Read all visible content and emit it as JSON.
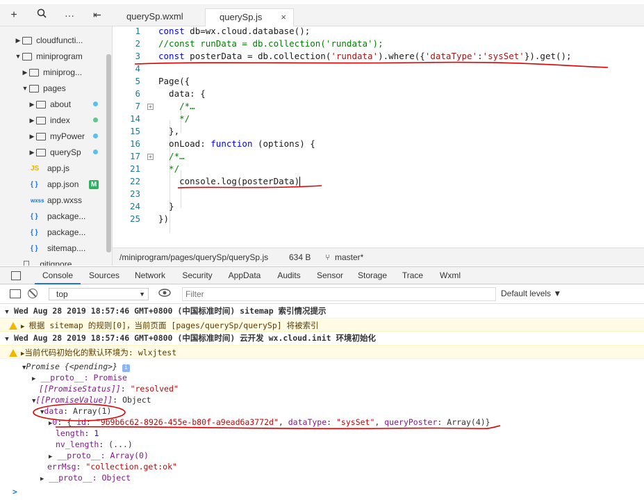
{
  "file_toolbar": {
    "add_icon": "plus-icon",
    "search_icon": "search-icon",
    "more_icon": "more-icon",
    "collapse_icon": "collapse-icon"
  },
  "sidebar": {
    "items": [
      {
        "label": "cloudfuncti...",
        "kind": "folder",
        "expanded": false
      },
      {
        "label": "miniprogram",
        "kind": "folder",
        "expanded": true
      },
      {
        "label": "miniprog...",
        "kind": "folder",
        "expanded": false
      },
      {
        "label": "pages",
        "kind": "folder",
        "expanded": true
      },
      {
        "label": "about",
        "kind": "folder",
        "expanded": false
      },
      {
        "label": "index",
        "kind": "folder",
        "expanded": false
      },
      {
        "label": "myPower",
        "kind": "folder",
        "expanded": false
      },
      {
        "label": "querySp",
        "kind": "folder",
        "expanded": false
      },
      {
        "label": "app.js",
        "kind": "file",
        "icon": "JS"
      },
      {
        "label": "app.json",
        "kind": "file",
        "icon": "{ }",
        "badge": "M"
      },
      {
        "label": "app.wxss",
        "kind": "file",
        "icon": "wxss"
      },
      {
        "label": "package...",
        "kind": "file",
        "icon": "{ }"
      },
      {
        "label": "package...",
        "kind": "file",
        "icon": "{ }"
      },
      {
        "label": "sitemap....",
        "kind": "file",
        "icon": "{ }"
      },
      {
        "label": ".gitignore",
        "kind": "file",
        "icon": ""
      }
    ]
  },
  "tabs": [
    {
      "label": "querySp.wxml",
      "active": false
    },
    {
      "label": "querySp.js",
      "active": true,
      "close": "×"
    }
  ],
  "editor": {
    "lines": [
      {
        "n": "1",
        "text": "const db=wx.cloud.database();"
      },
      {
        "n": "2",
        "text": "//const runData = db.collection('rundata');"
      },
      {
        "n": "3",
        "text": "const posterData = db.collection('rundata').where({'dataType':'sysSet'}).get();"
      },
      {
        "n": "4",
        "text": ""
      },
      {
        "n": "5",
        "text": "Page({"
      },
      {
        "n": "6",
        "text": "  data: {"
      },
      {
        "n": "7",
        "text": "    /*…"
      },
      {
        "n": "14",
        "text": "    */"
      },
      {
        "n": "15",
        "text": "  },"
      },
      {
        "n": "16",
        "text": "  onLoad: function (options) {"
      },
      {
        "n": "17",
        "text": "  /*…"
      },
      {
        "n": "21",
        "text": "  */"
      },
      {
        "n": "22",
        "text": "    console.log(posterData)"
      },
      {
        "n": "23",
        "text": ""
      },
      {
        "n": "24",
        "text": "  }"
      },
      {
        "n": "25",
        "text": "})"
      }
    ]
  },
  "statusbar": {
    "path": "/miniprogram/pages/querySp/querySp.js",
    "size": "634 B",
    "branch": "master*"
  },
  "devtools": {
    "tabs": [
      "Console",
      "Sources",
      "Network",
      "Security",
      "AppData",
      "Audits",
      "Sensor",
      "Storage",
      "Trace",
      "Wxml"
    ],
    "active_tab": "Console",
    "context": "top",
    "filter_placeholder": "Filter",
    "levels": "Default levels ▼"
  },
  "console": {
    "log1_time": "Wed Aug 28 2019 18:57:46 GMT+0800 (中国标准时间) sitemap 索引情况提示",
    "warn1": "根据 sitemap 的规则[0]，当前页面 [pages/querySp/querySp] 将被索引",
    "log2_time": "Wed Aug 28 2019 18:57:46 GMT+0800 (中国标准时间) 云开发 wx.cloud.init 环境初始化",
    "warn2": "当前代码初始化的默认环境为: wlxjtest",
    "promise": "Promise {<pending>}",
    "proto1": "__proto__: Promise",
    "status_key": "[[PromiseStatus]]",
    "status_val": "\"resolved\"",
    "value_key": "[[PromiseValue]]",
    "value_val": "Object",
    "data_key": "data",
    "data_val": "Array(1)",
    "item0_key": "0",
    "item0_id_key": "_id",
    "item0_id_val": "\"9b9b6c62-8926-455e-b80f-a9ead6a3772d\"",
    "item0_type_key": "dataType",
    "item0_type_val": "\"sysSet\"",
    "item0_qp_key": "queryPoster",
    "item0_qp_val": "Array(4)",
    "length_key": "length",
    "length_val": "1",
    "nvlength_key": "nv_length",
    "nvlength_val": "(...)",
    "proto2": "__proto__: Array(0)",
    "errmsg_key": "errMsg",
    "errmsg_val": "\"collection.get:ok\"",
    "proto3": "__proto__: Object",
    "prompt": ">"
  }
}
